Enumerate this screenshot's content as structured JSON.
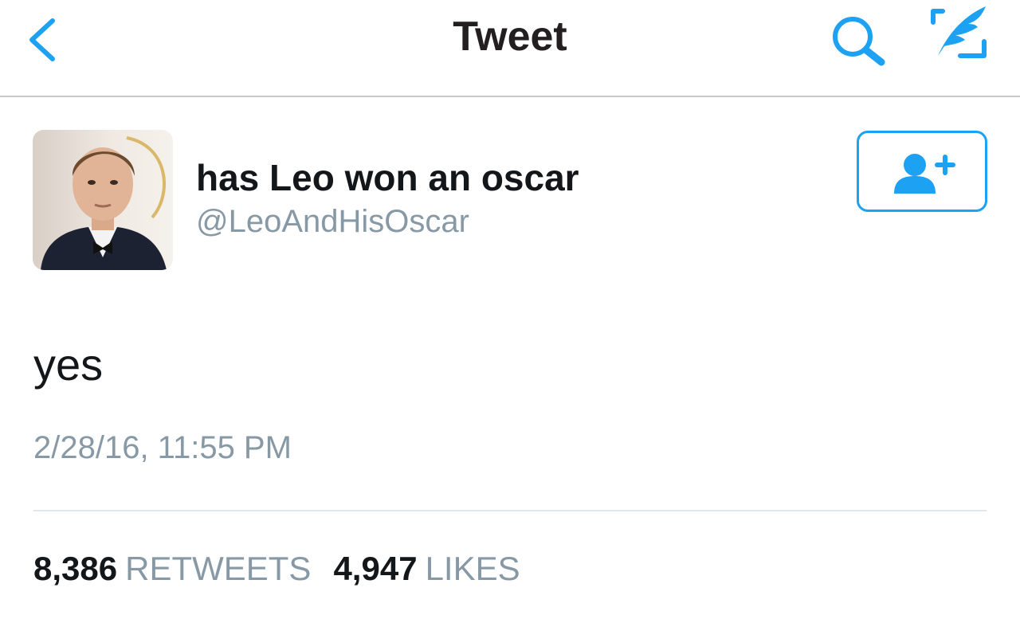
{
  "nav": {
    "title": "Tweet",
    "back_icon": "chevron-left-icon",
    "search_icon": "search-icon",
    "compose_icon": "compose-tweet-icon",
    "accent_color": "#1da1f2"
  },
  "author": {
    "display_name": "has Leo won an oscar",
    "handle": "@LeoAndHisOscar",
    "follow_icon": "follow-user-icon"
  },
  "tweet": {
    "text": "yes",
    "timestamp": "2/28/16, 11:55 PM"
  },
  "stats": {
    "retweets_count": "8,386",
    "retweets_label": "RETWEETS",
    "likes_count": "4,947",
    "likes_label": "LIKES"
  }
}
